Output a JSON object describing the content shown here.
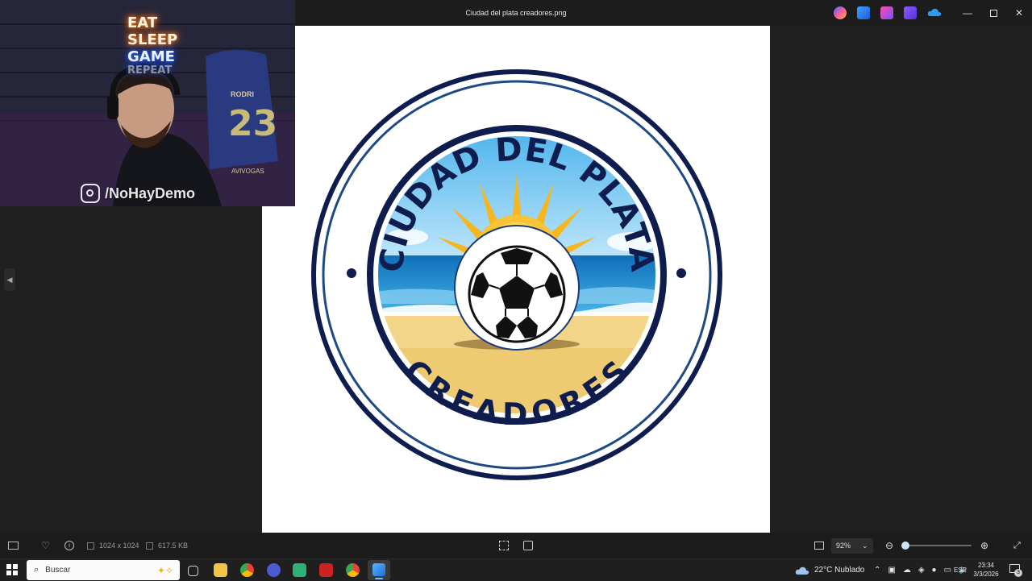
{
  "window": {
    "title": "Ciudad del plata creadores.png"
  },
  "logo": {
    "top_text": "CIUDAD DEL PLATA",
    "bottom_text": "CREADORES",
    "colors": {
      "navy": "#0f1f4f",
      "sky": "#7cc8f0",
      "sea": "#1a86c8",
      "sand": "#f3d58a",
      "sun": "#f7b51e"
    }
  },
  "webcam": {
    "neon_lines": [
      "EAT",
      "SLEEP",
      "GAME",
      "REPEAT"
    ],
    "jersey_name": "RODRI",
    "jersey_number": "23",
    "jersey_brand": "AVIVOGAS",
    "handle": "/NoHayDemo"
  },
  "statusbar": {
    "dimensions": "1024 x 1024",
    "file_size": "617.5 KB",
    "zoom": "92%",
    "zoom_fraction": 0.05
  },
  "taskbar": {
    "search_placeholder": "Buscar",
    "weather": "22°C  Nublado",
    "language": "ESP",
    "time": "23:34",
    "date": "3/3/2026",
    "notification_count": "3"
  }
}
